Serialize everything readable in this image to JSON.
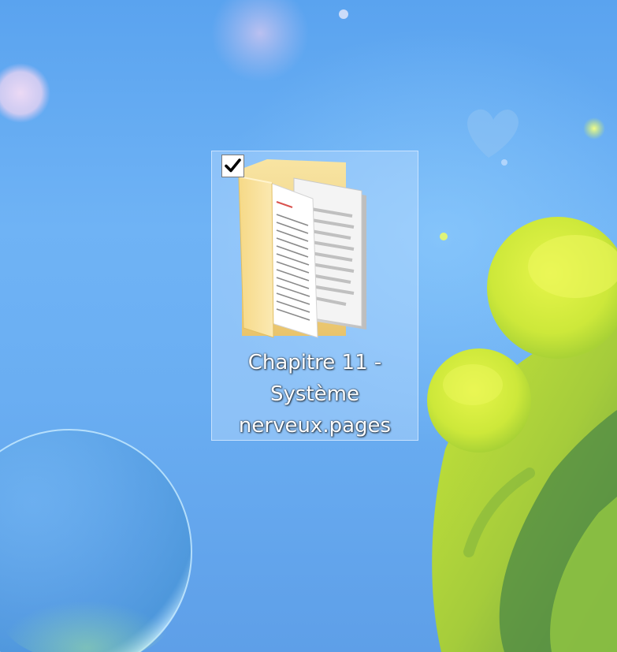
{
  "desktop": {
    "icon": {
      "name_lines": [
        "Chapitre 11 -",
        "Système",
        "nerveux.pages"
      ],
      "selected": true,
      "checkbox_checked": true,
      "icon_type": "folder-with-documents-icon",
      "checkmark_icon": "checkmark-icon"
    }
  },
  "colors": {
    "wallpaper_blue": "#6aaef2",
    "selection_fill": "#bedeff",
    "selection_border": "#d2e8ff",
    "folder_yellow": "#f7dc8e",
    "cactus_green": "#c9e83c",
    "label_text": "#ffffff"
  }
}
